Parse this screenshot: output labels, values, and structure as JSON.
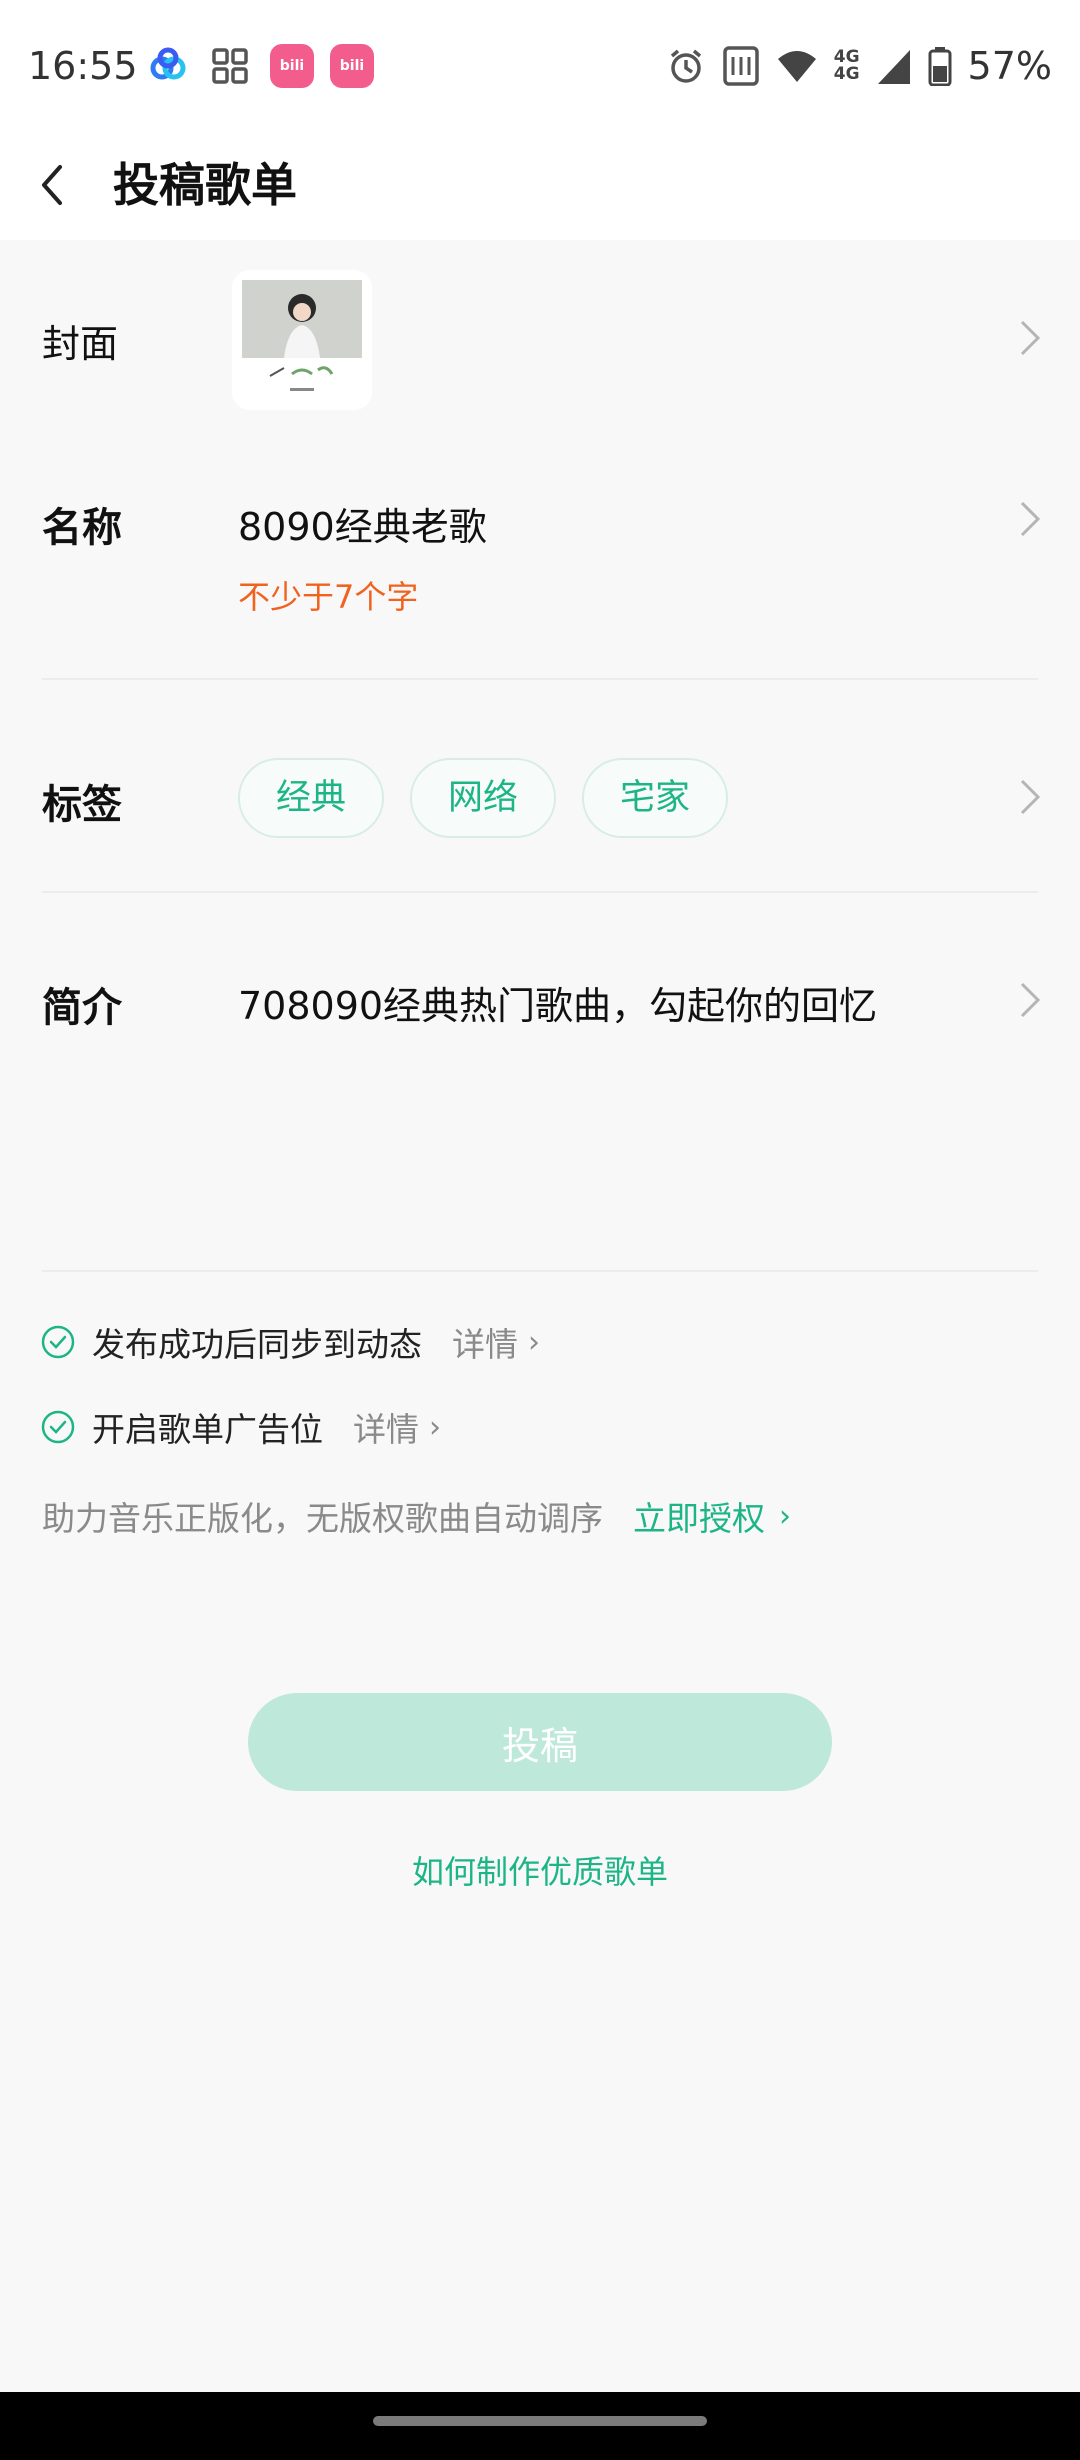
{
  "status_bar": {
    "time": "16:55",
    "battery": "57%",
    "network_top": "4G",
    "network_bottom": "4G",
    "icons": [
      "baidu-netdisk-icon",
      "app-grid-icon",
      "bilibili-icon",
      "bilibili-icon",
      "alarm-icon",
      "nfc-icon",
      "wifi-icon",
      "signal-icon",
      "battery-icon"
    ]
  },
  "header": {
    "title": "投稿歌单"
  },
  "form": {
    "cover_label": "封面",
    "name_label": "名称",
    "name_value": "8090经典老歌",
    "name_hint": "不少于7个字",
    "tags_label": "标签",
    "tags": [
      "经典",
      "网络",
      "宅家"
    ],
    "intro_label": "简介",
    "intro_value": "708090经典热门歌曲，勾起你的回忆"
  },
  "options": {
    "sync_label": "发布成功后同步到动态",
    "sync_detail": "详情",
    "ad_label": "开启歌单广告位",
    "ad_detail": "详情",
    "copyright_text": "助力音乐正版化，无版权歌曲自动调序",
    "copyright_link": "立即授权"
  },
  "actions": {
    "submit_label": "投稿",
    "howto_label": "如何制作优质歌单"
  },
  "colors": {
    "accent": "#1db586",
    "hint": "#f0631f",
    "submit_disabled": "#bde8da",
    "background": "#f8f8f8"
  }
}
